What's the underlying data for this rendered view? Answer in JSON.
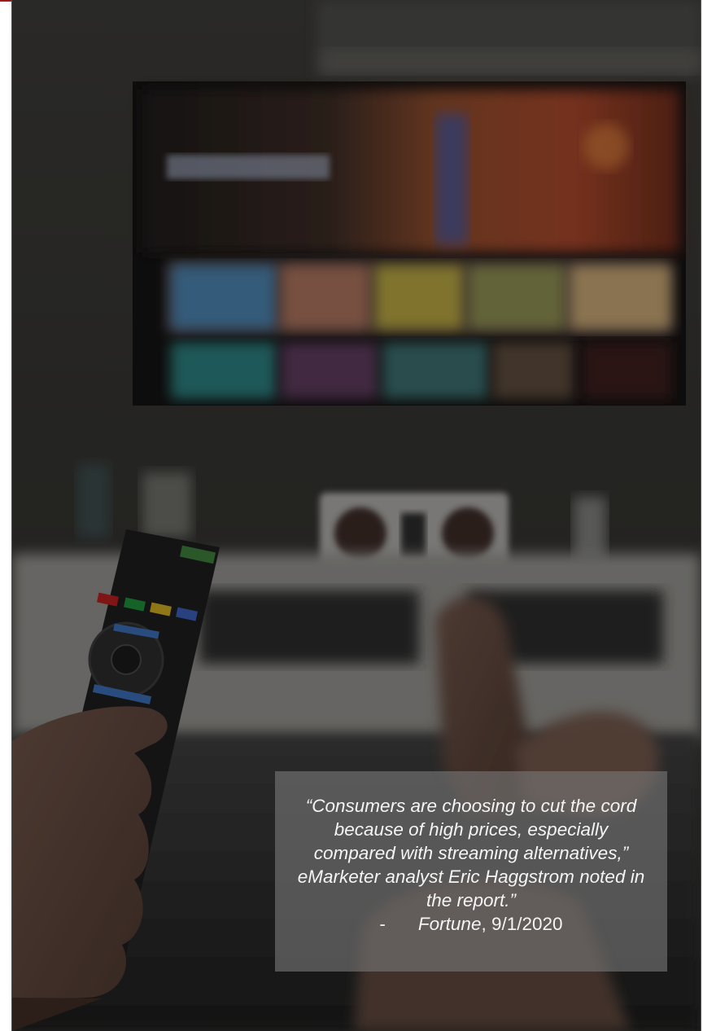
{
  "quote": {
    "text": "“Consumers are choosing to cut the cord because of high prices, especially compared with streaming alternatives,” eMarketer analyst Eric Haggstrom noted in the report.”",
    "dash": "-",
    "source_name": "Fortune",
    "source_date": ", 9/1/2020"
  },
  "colors": {
    "accent": "#a3191b",
    "overlay": "#787878",
    "photo_dark": "#2d2c2a"
  }
}
